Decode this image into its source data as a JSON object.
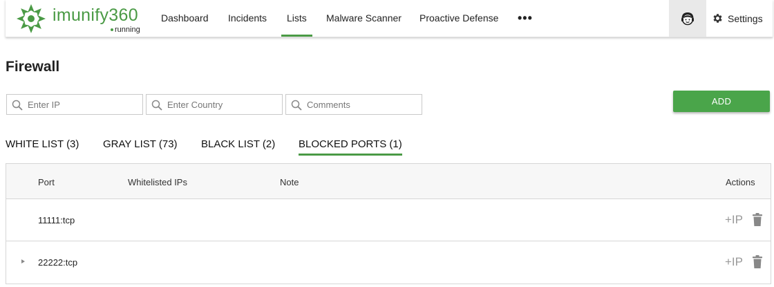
{
  "app": {
    "logo_text": "imunify360",
    "status": "running",
    "brand_color": "#4a9a45"
  },
  "nav": {
    "items": [
      {
        "label": "Dashboard"
      },
      {
        "label": "Incidents"
      },
      {
        "label": "Lists",
        "active": true
      },
      {
        "label": "Malware Scanner"
      },
      {
        "label": "Proactive Defense"
      }
    ],
    "more_label": "•••",
    "support_icon": "support-agent-icon",
    "settings_label": "Settings"
  },
  "page": {
    "title": "Firewall"
  },
  "filters": {
    "ip_placeholder": "Enter IP",
    "country_placeholder": "Enter Country",
    "comments_placeholder": "Comments",
    "ip_value": "",
    "country_value": "",
    "comments_value": ""
  },
  "add_button_label": "ADD",
  "tabs": [
    {
      "label": "WHITE LIST (3)"
    },
    {
      "label": "GRAY LIST (73)"
    },
    {
      "label": "BLACK LIST (2)"
    },
    {
      "label": "BLOCKED PORTS (1)",
      "active": true
    }
  ],
  "table": {
    "headers": {
      "port": "Port",
      "whitelisted_ips": "Whitelisted IPs",
      "note": "Note",
      "actions": "Actions"
    },
    "rows": [
      {
        "port": "11111:tcp",
        "whitelisted_ips": "",
        "note": "",
        "expandable": false,
        "add_ip_label": "+IP"
      },
      {
        "port": "22222:tcp",
        "whitelisted_ips": "",
        "note": "",
        "expandable": true,
        "add_ip_label": "+IP"
      }
    ]
  }
}
